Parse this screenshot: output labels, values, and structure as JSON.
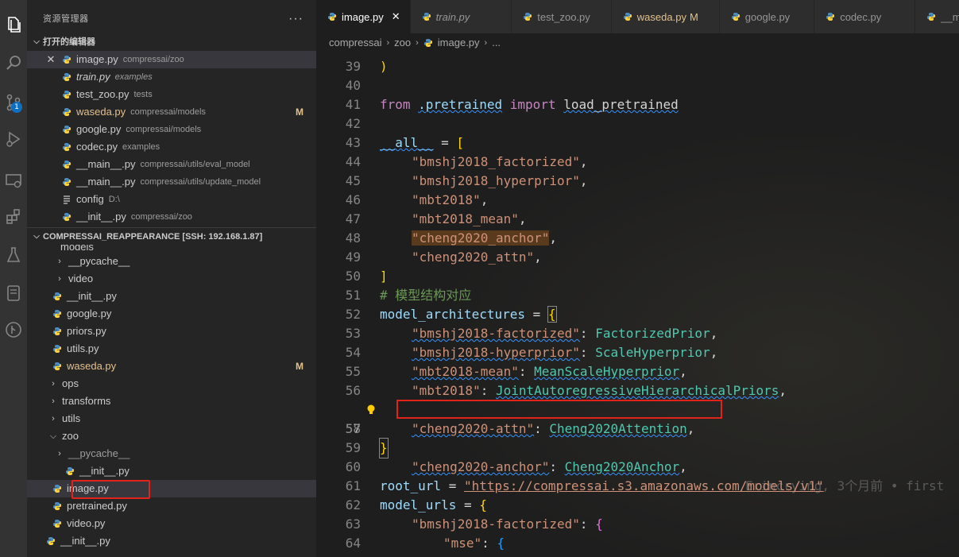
{
  "activity_bar": {
    "icons": [
      "files-icon",
      "search-icon",
      "source-control-icon",
      "run-debug-icon",
      "remote-explorer-icon",
      "extensions-icon",
      "testing-icon",
      "docker-icon",
      "git-graph-icon"
    ],
    "scm_badge": "1"
  },
  "sidebar": {
    "title": "资源管理器",
    "more": "···",
    "open_editors": {
      "header": "打开的编辑器",
      "items": [
        {
          "name": "image.py",
          "desc": "compressai/zoo"
        },
        {
          "name": "train.py",
          "desc": "examples"
        },
        {
          "name": "test_zoo.py",
          "desc": "tests"
        },
        {
          "name": "waseda.py",
          "desc": "compressai/models",
          "badge": "M"
        },
        {
          "name": "google.py",
          "desc": "compressai/models"
        },
        {
          "name": "codec.py",
          "desc": "examples"
        },
        {
          "name": "__main__.py",
          "desc": "compressai/utils/eval_model"
        },
        {
          "name": "__main__.py",
          "desc": "compressai/utils/update_model"
        },
        {
          "name": "config",
          "desc": "D:\\"
        },
        {
          "name": "__init__.py",
          "desc": "compressai/zoo"
        }
      ]
    },
    "workspace": {
      "header": "COMPRESSAI_REAPPEARANCE [SSH: 192.168.1.87]",
      "partial_top": "models",
      "tree": [
        {
          "name": "__pycache__"
        },
        {
          "name": "video"
        },
        {
          "name": "__init__.py"
        },
        {
          "name": "google.py"
        },
        {
          "name": "priors.py"
        },
        {
          "name": "utils.py"
        },
        {
          "name": "waseda.py",
          "badge": "M"
        },
        {
          "name": "ops"
        },
        {
          "name": "transforms"
        },
        {
          "name": "utils"
        },
        {
          "name": "zoo"
        },
        {
          "name": "__pycache__"
        },
        {
          "name": "__init__.py"
        },
        {
          "name": "image.py"
        },
        {
          "name": "pretrained.py"
        },
        {
          "name": "video.py"
        },
        {
          "name": "__init__.py"
        }
      ]
    }
  },
  "editor": {
    "tabs": [
      {
        "label": "image.py",
        "close": "✕"
      },
      {
        "label": "train.py"
      },
      {
        "label": "test_zoo.py"
      },
      {
        "label": "waseda.py",
        "badge": "M"
      },
      {
        "label": "google.py"
      },
      {
        "label": "codec.py"
      },
      {
        "label": "__main"
      }
    ],
    "breadcrumb": [
      "compressai",
      "zoo",
      "image.py",
      "..."
    ],
    "blame": "Erincrying, 3个月前 • first",
    "lines": {
      "n39": "39",
      "n40": "40",
      "n41": "41",
      "n42": "42",
      "n43": "43",
      "n44": "44",
      "n45": "45",
      "n46": "46",
      "n47": "47",
      "n48": "48",
      "n49": "49",
      "n50": "50",
      "n51": "51",
      "n52": "52",
      "n53": "53",
      "n54": "54",
      "n55": "55",
      "n56": "56",
      "n57": "57",
      "n58": "58",
      "n59": "59",
      "n60": "60",
      "n61": "61",
      "n62": "62",
      "n63": "63",
      "n64": "64"
    },
    "code": {
      "from": "from",
      "mod": ".pretrained",
      "import": "import",
      "fn": "load_pretrained",
      "all": "__all__",
      "eq": " = ",
      "a1": "\"bmshj2018_factorized\"",
      "a2": "\"bmshj2018_hyperprior\"",
      "a3": "\"mbt2018\"",
      "a4": "\"mbt2018_mean\"",
      "a5": "\"cheng2020_anchor\"",
      "a6": "\"cheng2020_attn\"",
      "comment": "# 模型结构对应",
      "arch": "model_architectures",
      "k1": "\"bmshj2018-factorized\"",
      "v1": "FactorizedPrior",
      "k2": "\"bmshj2018-hyperprior\"",
      "v2": "ScaleHyperprior",
      "k3": "\"mbt2018-mean\"",
      "v3": "MeanScaleHyperprior",
      "k4": "\"mbt2018\"",
      "v4": "JointAutoregressiveHierarchicalPriors",
      "k5": "\"cheng2020-anchor\"",
      "v5": "Cheng2020Anchor",
      "k6": "\"cheng2020-attn\"",
      "v6": "Cheng2020Attention",
      "root": "root_url",
      "url": "\"https://compressai.s3.amazonaws.com/models/v1\"",
      "urls": "model_urls",
      "k7": "\"bmshj2018-factorized\"",
      "mse": "\"mse\""
    }
  },
  "colors": {
    "annotation_box": "#e2231a",
    "accent_blue": "#0e70c0",
    "modified": "#e2c08d"
  }
}
